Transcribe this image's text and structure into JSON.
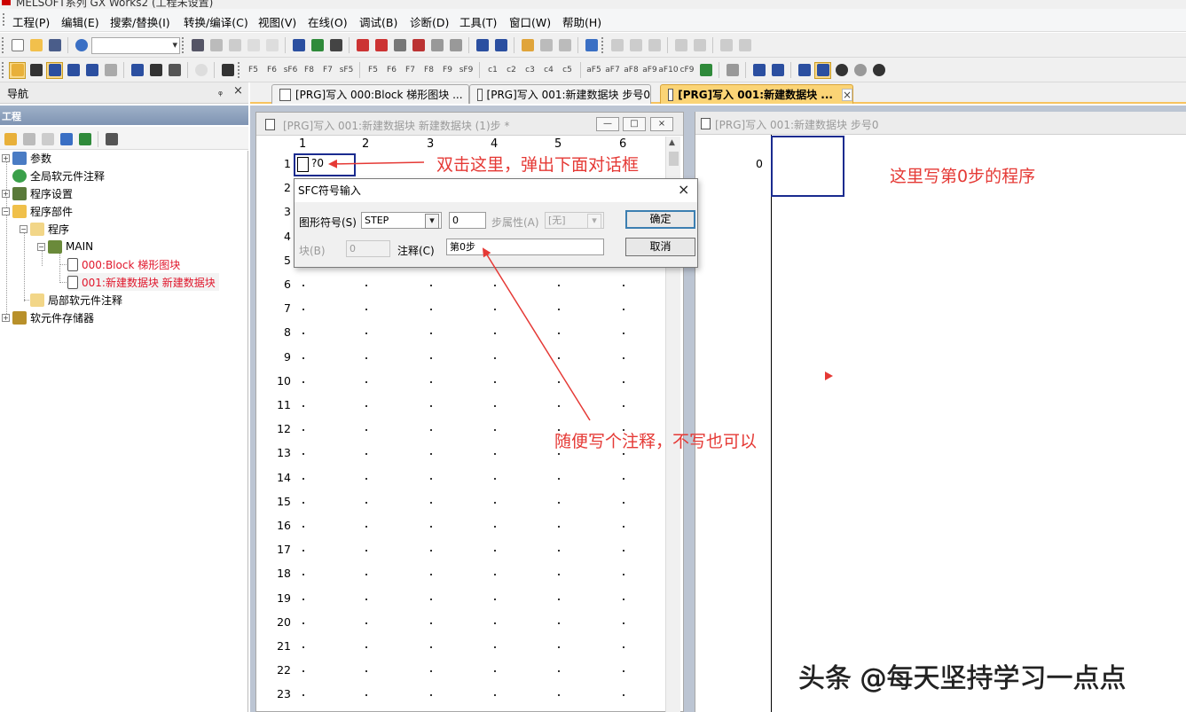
{
  "window": {
    "title": "MELSOFT系列 GX Works2 (工程未设置)"
  },
  "menu": [
    "工程(P)",
    "编辑(E)",
    "搜索/替换(I)",
    "转换/编译(C)",
    "视图(V)",
    "在线(O)",
    "调试(B)",
    "诊断(D)",
    "工具(T)",
    "窗口(W)",
    "帮助(H)"
  ],
  "nav": {
    "title": "导航",
    "pin": "ᵩ",
    "close": "×",
    "section": "工程",
    "tree": [
      {
        "label": "参数",
        "expander": "+"
      },
      {
        "label": "全局软元件注释",
        "expander": ""
      },
      {
        "label": "程序设置",
        "expander": "+"
      },
      {
        "label": "程序部件",
        "expander": "−"
      },
      {
        "label": "程序",
        "expander": "−"
      },
      {
        "label": "MAIN",
        "expander": "−"
      },
      {
        "label": "000:Block 梯形图块",
        "expander": ""
      },
      {
        "label": "001:新建数据块 新建数据块",
        "expander": ""
      },
      {
        "label": "局部软元件注释",
        "expander": ""
      },
      {
        "label": "软元件存储器",
        "expander": "+"
      }
    ]
  },
  "tabs": [
    {
      "label": "[PRG]写入 000:Block 梯形图块 ..."
    },
    {
      "label": "[PRG]写入 001:新建数据块 步号0"
    },
    {
      "label": "[PRG]写入 001:新建数据块 ...",
      "close": "×"
    }
  ],
  "left_window": {
    "title": "[PRG]写入 001:新建数据块 新建数据块 (1)步 *",
    "buttons": {
      "min": "—",
      "max": "□",
      "close": "×"
    },
    "columns": [
      "1",
      "2",
      "3",
      "4",
      "5",
      "6"
    ],
    "rows": [
      "1",
      "2",
      "3",
      "4",
      "5",
      "6",
      "7",
      "8",
      "9",
      "10",
      "11",
      "12",
      "13",
      "14",
      "15",
      "16",
      "17",
      "18",
      "19",
      "20",
      "21",
      "22",
      "23"
    ],
    "step_label": "?0"
  },
  "right_window": {
    "title": "[PRG]写入 001:新建数据块 步号0",
    "step_number": "0"
  },
  "dialog": {
    "title": "SFC符号输入",
    "close": "×",
    "symbol_label": "图形符号(S)",
    "symbol_value": "STEP",
    "step_no_value": "0",
    "attr_label": "步属性(A)",
    "attr_value": "[无]",
    "block_label": "块(B)",
    "block_value": "0",
    "comment_label": "注释(C)",
    "comment_value": "第0步",
    "ok_label": "确定",
    "cancel_label": "取消"
  },
  "annotations": {
    "a1": "双击这里，弹出下面对话框",
    "a2": "这里写第0步的程序",
    "a3": "随便写个注释，不写也可以"
  },
  "watermark": "头条 @每天坚持学习一点点",
  "colors": {
    "annotation": "#e53935",
    "active_tab": "#fbd476",
    "cell_border": "#1a2b8f"
  }
}
